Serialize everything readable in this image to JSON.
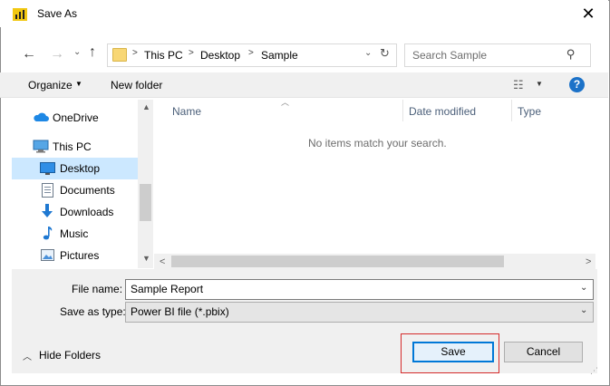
{
  "window": {
    "title": "Save As",
    "close_glyph": "✕"
  },
  "nav": {
    "breadcrumb": [
      "This PC",
      "Desktop",
      "Sample"
    ],
    "search_placeholder": "Search Sample"
  },
  "toolbar": {
    "organize": "Organize",
    "new_folder": "New folder",
    "help": "?"
  },
  "sidebar": {
    "items": [
      {
        "label": "OneDrive",
        "icon": "onedrive-icon"
      },
      {
        "label": "This PC",
        "icon": "computer-icon"
      },
      {
        "label": "Desktop",
        "icon": "desktop-icon",
        "selected": true
      },
      {
        "label": "Documents",
        "icon": "documents-icon"
      },
      {
        "label": "Downloads",
        "icon": "downloads-icon"
      },
      {
        "label": "Music",
        "icon": "music-icon"
      },
      {
        "label": "Pictures",
        "icon": "pictures-icon"
      }
    ]
  },
  "content": {
    "columns": [
      "Name",
      "Date modified",
      "Type"
    ],
    "empty_message": "No items match your search."
  },
  "form": {
    "file_name_label": "File name:",
    "file_name_value": "Sample Report",
    "save_as_type_label": "Save as type:",
    "save_as_type_value": "Power BI file (*.pbix)"
  },
  "footer": {
    "hide_folders": "Hide Folders",
    "save": "Save",
    "cancel": "Cancel"
  },
  "colors": {
    "accent": "#0078d7",
    "selection": "#cce8ff",
    "highlight_box": "#d52b2b",
    "powerbi_yellow": "#f2c811"
  }
}
